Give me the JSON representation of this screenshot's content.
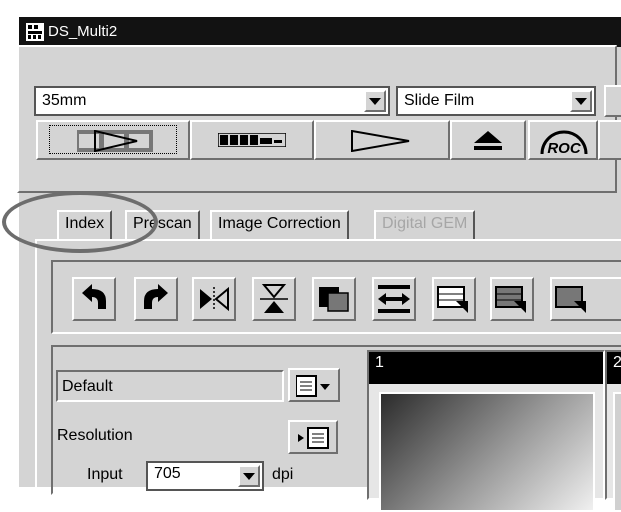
{
  "window": {
    "title": "DS_Multi2"
  },
  "top": {
    "film_size": "35mm",
    "film_type": "Slide Film"
  },
  "tabs": [
    {
      "label": "Index"
    },
    {
      "label": "Prescan"
    },
    {
      "label": "Image Correction"
    },
    {
      "label": "Digital GEM"
    }
  ],
  "settings": {
    "profile": "Default",
    "resolution_label": "Resolution",
    "input_label": "Input",
    "input_value": "705",
    "input_unit": "dpi"
  },
  "thumbnails": [
    {
      "number": "1"
    },
    {
      "number": "2"
    }
  ],
  "toolbar_buttons": [
    "ROC"
  ]
}
